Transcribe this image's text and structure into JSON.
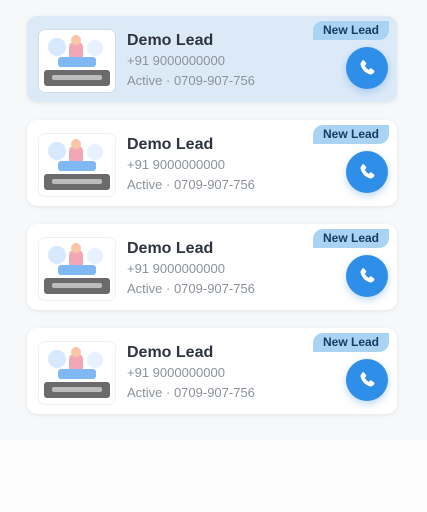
{
  "leads": [
    {
      "name": "Demo Lead",
      "phone": "+91 9000000000",
      "status": "Active · 0709-907-756",
      "tag": "New Lead",
      "selected": true,
      "thumbnail_icon": "lead-avatar-illustration-icon",
      "call_icon": "phone-icon"
    },
    {
      "name": "Demo Lead",
      "phone": "+91 9000000000",
      "status": "Active · 0709-907-756",
      "tag": "New Lead",
      "selected": false,
      "thumbnail_icon": "lead-avatar-illustration-icon",
      "call_icon": "phone-icon"
    },
    {
      "name": "Demo Lead",
      "phone": "+91 9000000000",
      "status": "Active · 0709-907-756",
      "tag": "New Lead",
      "selected": false,
      "thumbnail_icon": "lead-avatar-illustration-icon",
      "call_icon": "phone-icon"
    },
    {
      "name": "Demo Lead",
      "phone": "+91 9000000000",
      "status": "Active · 0709-907-756",
      "tag": "New Lead",
      "selected": false,
      "thumbnail_icon": "lead-avatar-illustration-icon",
      "call_icon": "phone-icon"
    }
  ],
  "colors": {
    "selected_card": "#dceaf8",
    "card": "#ffffff",
    "tag": "#a9d2f3",
    "call_button": "#2f8ee8"
  }
}
